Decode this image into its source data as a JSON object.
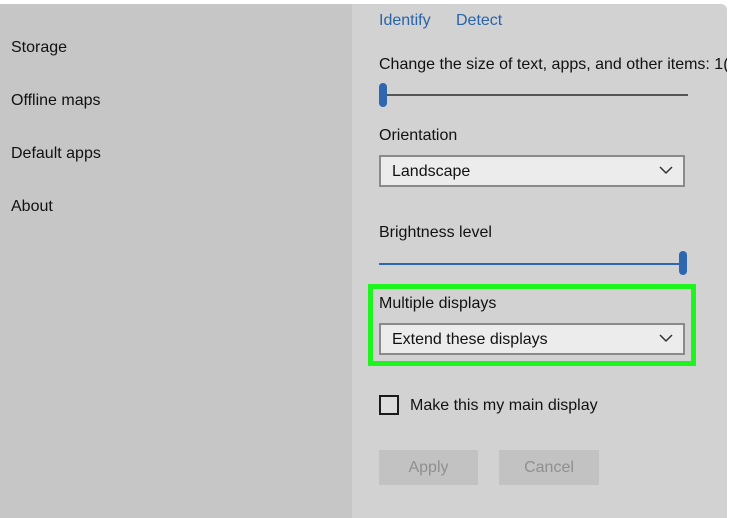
{
  "sidebar": {
    "items": [
      {
        "label": "Storage"
      },
      {
        "label": "Offline maps"
      },
      {
        "label": "Default apps"
      },
      {
        "label": "About"
      }
    ]
  },
  "display": {
    "identify_label": "Identify",
    "detect_label": "Detect",
    "scale_label": "Change the size of text, apps, and other items: 1(",
    "scale_slider_level": 0.0,
    "orientation_label": "Orientation",
    "orientation_value": "Landscape",
    "brightness_label": "Brightness level",
    "brightness_level": 1.0,
    "multiple_displays_label": "Multiple displays",
    "multiple_displays_value": "Extend these displays",
    "main_display_checkbox_label": "Make this my main display",
    "main_display_checked": false,
    "apply_label": "Apply",
    "cancel_label": "Cancel"
  },
  "colors": {
    "accent": "#2e66b0",
    "highlight": "#1ef51e",
    "link": "#2a63a8"
  },
  "icons": {
    "dropdown": "chevron-down-icon"
  }
}
